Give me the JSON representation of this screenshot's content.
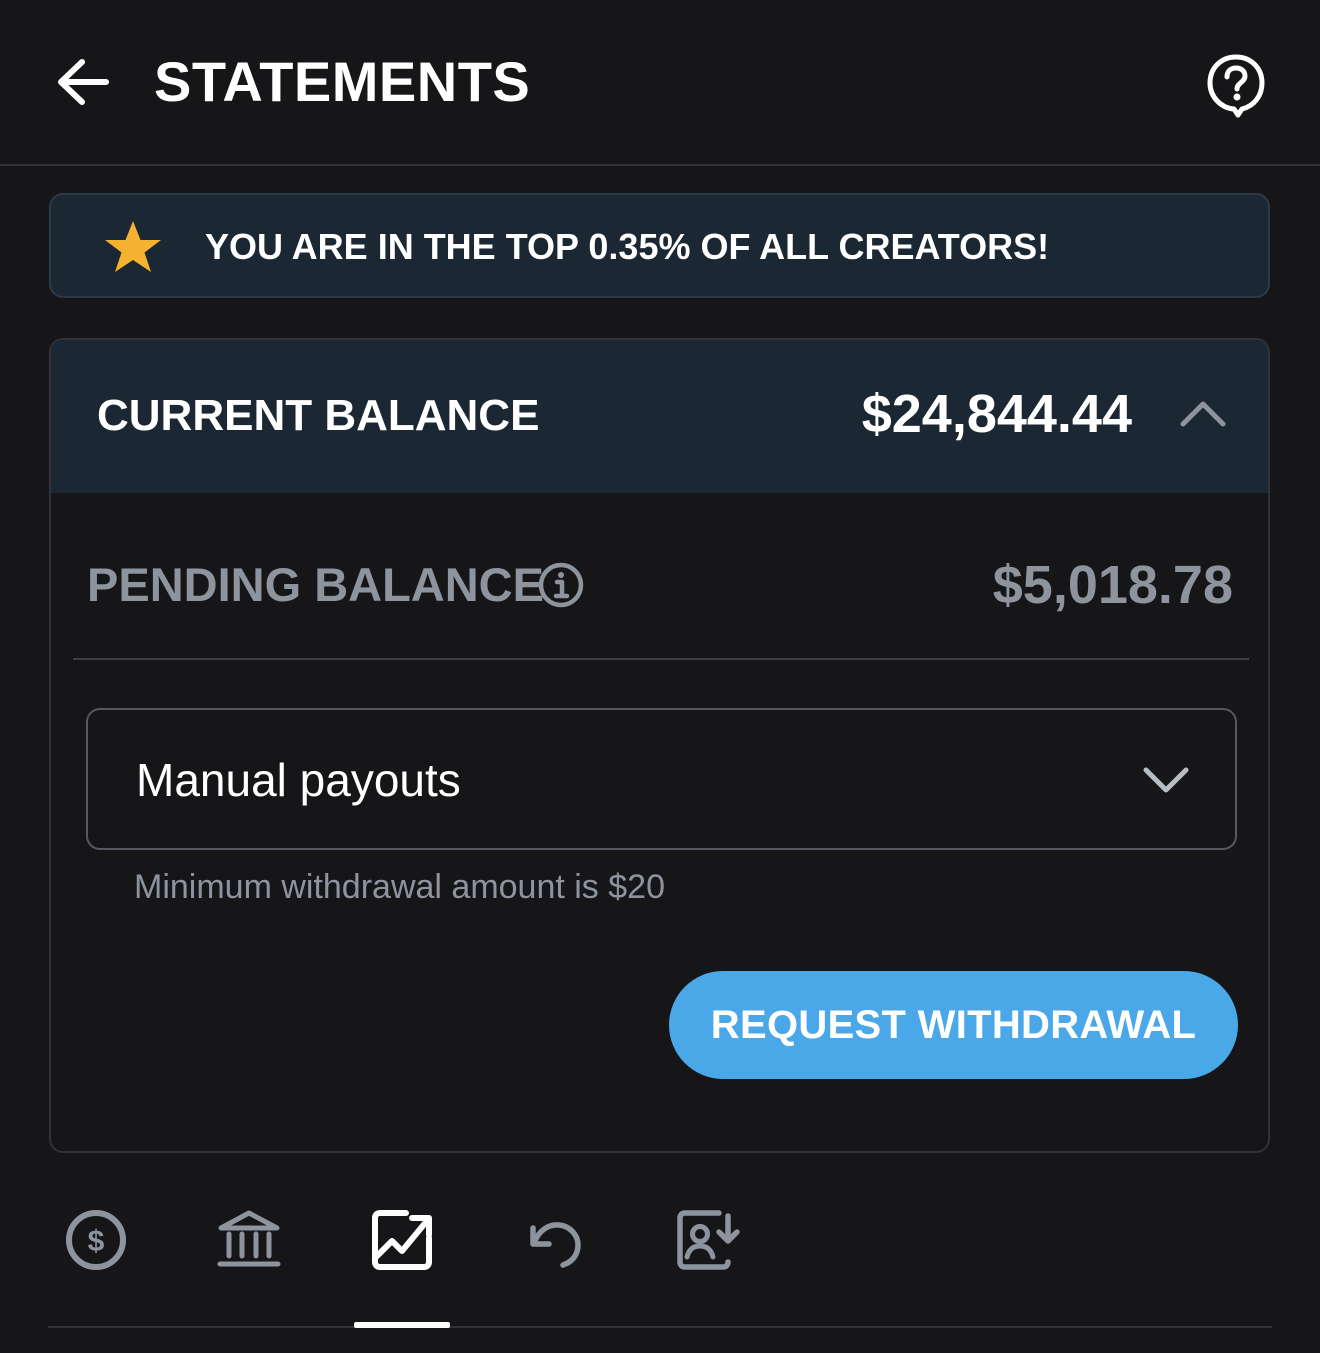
{
  "header": {
    "title": "STATEMENTS",
    "back_icon": "arrow-left-icon",
    "help_icon": "help-bubble-icon"
  },
  "banner": {
    "icon": "star-icon",
    "text": "YOU ARE IN THE TOP 0.35% OF ALL CREATORS!",
    "star_color": "#f5b230"
  },
  "balance": {
    "current_label": "CURRENT BALANCE",
    "current_amount": "$24,844.44",
    "collapse_icon": "chevron-up-icon",
    "pending_label": "PENDING BALANCE",
    "pending_info_icon": "info-icon",
    "pending_amount": "$5,018.78"
  },
  "payout": {
    "selected_option": "Manual payouts",
    "dropdown_icon": "chevron-down-icon",
    "hint": "Minimum withdrawal amount is $20",
    "withdraw_button": "REQUEST WITHDRAWAL",
    "accent_color": "#4aa8e8"
  },
  "tabs": [
    {
      "icon": "dollar-circle-icon",
      "active": false
    },
    {
      "icon": "bank-icon",
      "active": false
    },
    {
      "icon": "chart-trend-icon",
      "active": true
    },
    {
      "icon": "undo-icon",
      "active": false
    },
    {
      "icon": "user-download-icon",
      "active": false
    }
  ]
}
